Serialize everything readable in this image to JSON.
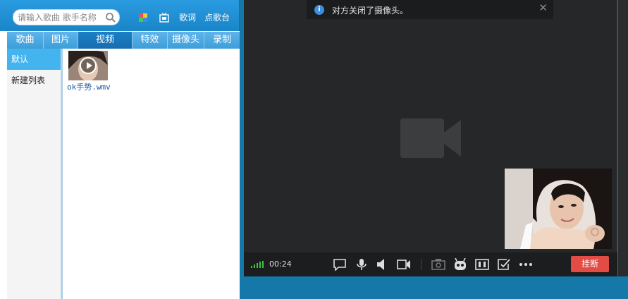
{
  "search": {
    "placeholder": "请输入歌曲 歌手名称"
  },
  "toplinks": {
    "lyrics": "歌词",
    "request_song": "点歌台"
  },
  "tabs": [
    "歌曲",
    "图片",
    "视频",
    "特效",
    "摄像头",
    "录制"
  ],
  "active_tab": "视频",
  "playlists": [
    "默认",
    "新建列表"
  ],
  "media_items": [
    {
      "label": "ok手势.wmv"
    }
  ],
  "notification": {
    "text": "对方关闭了摄像头。"
  },
  "call": {
    "timer": "00:24",
    "hangup_label": "挂断"
  },
  "colors": {
    "accent": "#1a85c9",
    "hangup": "#e34b45",
    "video_bg": "#262729",
    "signal": "#3cc43c"
  },
  "icons": [
    "search-icon",
    "skin-icon",
    "tv-icon",
    "info-icon",
    "close-icon",
    "camera-off-icon",
    "chat-icon",
    "microphone-icon",
    "speaker-icon",
    "video-camera-icon",
    "snapshot-icon",
    "robot-icon",
    "layout-icon",
    "share-icon",
    "more-icon",
    "signal-icon"
  ]
}
